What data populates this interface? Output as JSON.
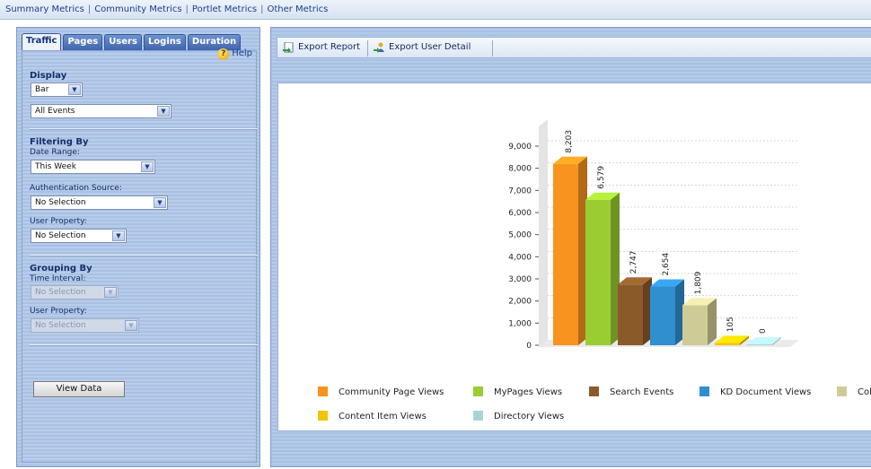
{
  "topnav": {
    "links": [
      "Summary Metrics",
      "Community Metrics",
      "Portlet Metrics",
      "Other Metrics"
    ]
  },
  "tabs": [
    "Traffic",
    "Pages",
    "Users",
    "Logins",
    "Duration"
  ],
  "help_label": "Help",
  "display": {
    "heading": "Display",
    "chart_type": "Bar",
    "events": "All Events"
  },
  "filtering": {
    "heading": "Filtering By",
    "date_range_label": "Date Range:",
    "date_range_value": "This Week",
    "auth_source_label": "Authentication Source:",
    "auth_source_value": "No Selection",
    "user_property_label": "User Property:",
    "user_property_value": "No Selection"
  },
  "grouping": {
    "heading": "Grouping By",
    "time_interval_label": "Time Interval:",
    "time_interval_value": "No Selection",
    "user_property_label": "User Property:",
    "user_property_value": "No Selection"
  },
  "view_data_label": "View Data",
  "toolbar": {
    "export_report": "Export Report",
    "export_user_detail": "Export User Detail"
  },
  "chart_data": {
    "type": "bar",
    "title": "",
    "xlabel": "",
    "ylabel": "",
    "ylim": [
      0,
      9000
    ],
    "yticks": [
      "0",
      "1,000",
      "2,000",
      "3,000",
      "4,000",
      "5,000",
      "6,000",
      "7,000",
      "8,000",
      "9,000"
    ],
    "grid": true,
    "legend_position": "bottom",
    "categories": [
      "Community Page Views",
      "MyPages Views",
      "Search Events",
      "KD Document Views",
      "Col",
      "Content Item Views",
      "Directory Views"
    ],
    "values": [
      8203,
      6579,
      2747,
      2654,
      1809,
      105,
      0
    ],
    "data_labels": [
      "8,203",
      "6,579",
      "2,747",
      "2,654",
      "1,809",
      "105",
      "0"
    ],
    "colors": [
      "#f7931e",
      "#9acd32",
      "#8b5a2b",
      "#2f8fcf",
      "#cfcb96",
      "#f2c500",
      "#a8d4d9"
    ]
  }
}
